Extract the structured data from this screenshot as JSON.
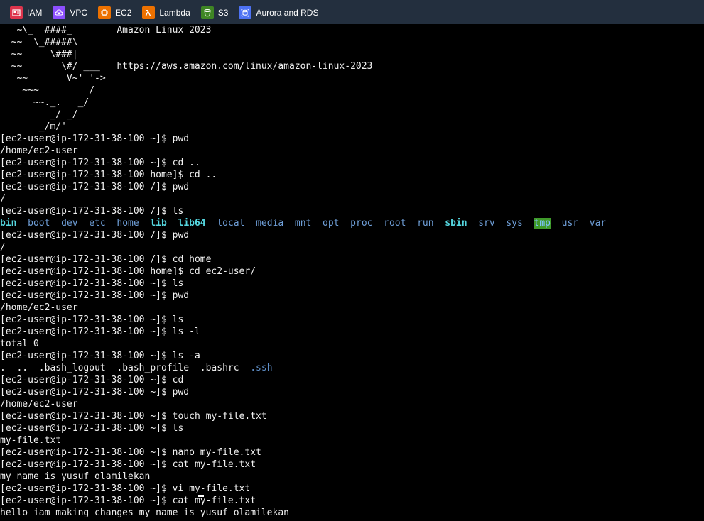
{
  "favorites": [
    {
      "label": "IAM",
      "icon": "iam-icon",
      "color": "#dd344c"
    },
    {
      "label": "VPC",
      "icon": "vpc-icon",
      "color": "#8c4fff"
    },
    {
      "label": "EC2",
      "icon": "ec2-icon",
      "color": "#ed7100"
    },
    {
      "label": "Lambda",
      "icon": "lambda-icon",
      "color": "#ed7100"
    },
    {
      "label": "S3",
      "icon": "s3-icon",
      "color": "#3f8624"
    },
    {
      "label": "Aurora and RDS",
      "icon": "rds-icon",
      "color": "#4d72f3"
    }
  ],
  "terminal": {
    "banner": [
      "   ~\\_  ####_        Amazon Linux 2023",
      "  ~~  \\_#####\\",
      "  ~~     \\###|",
      "  ~~       \\#/ ___   https://aws.amazon.com/linux/amazon-linux-2023",
      "   ~~       V~' '->",
      "    ~~~         /",
      "      ~~._.   _/",
      "         _/ _/",
      "       _/m/'"
    ],
    "prompts": {
      "home": "[ec2-user@ip-172-31-38-100 ~]$ ",
      "home_dir": "[ec2-user@ip-172-31-38-100 home]$ ",
      "root": "[ec2-user@ip-172-31-38-100 /]$ "
    },
    "history": [
      {
        "prompt": "[ec2-user@ip-172-31-38-100 ~]$ ",
        "command": "pwd"
      },
      {
        "output": "/home/ec2-user"
      },
      {
        "prompt": "[ec2-user@ip-172-31-38-100 ~]$ ",
        "command": "cd .."
      },
      {
        "prompt": "[ec2-user@ip-172-31-38-100 home]$ ",
        "command": "cd .."
      },
      {
        "prompt": "[ec2-user@ip-172-31-38-100 /]$ ",
        "command": "pwd"
      },
      {
        "output": "/"
      },
      {
        "prompt": "[ec2-user@ip-172-31-38-100 /]$ ",
        "command": "ls"
      },
      {
        "ls_root": true
      },
      {
        "prompt": "[ec2-user@ip-172-31-38-100 /]$ ",
        "command": "pwd"
      },
      {
        "output": "/"
      },
      {
        "prompt": "[ec2-user@ip-172-31-38-100 /]$ ",
        "command": "cd home"
      },
      {
        "prompt": "[ec2-user@ip-172-31-38-100 home]$ ",
        "command": "cd ec2-user/"
      },
      {
        "prompt": "[ec2-user@ip-172-31-38-100 ~]$ ",
        "command": "ls"
      },
      {
        "prompt": "[ec2-user@ip-172-31-38-100 ~]$ ",
        "command": "pwd"
      },
      {
        "output": "/home/ec2-user"
      },
      {
        "prompt": "[ec2-user@ip-172-31-38-100 ~]$ ",
        "command": "ls"
      },
      {
        "prompt": "[ec2-user@ip-172-31-38-100 ~]$ ",
        "command": "ls -l"
      },
      {
        "output": "total 0"
      },
      {
        "prompt": "[ec2-user@ip-172-31-38-100 ~]$ ",
        "command": "ls -a"
      },
      {
        "ls_hidden": true
      },
      {
        "prompt": "[ec2-user@ip-172-31-38-100 ~]$ ",
        "command": "cd"
      },
      {
        "prompt": "[ec2-user@ip-172-31-38-100 ~]$ ",
        "command": "pwd"
      },
      {
        "output": "/home/ec2-user"
      },
      {
        "prompt": "[ec2-user@ip-172-31-38-100 ~]$ ",
        "command": "touch my-file.txt"
      },
      {
        "prompt": "[ec2-user@ip-172-31-38-100 ~]$ ",
        "command": "ls"
      },
      {
        "output": "my-file.txt"
      },
      {
        "prompt": "[ec2-user@ip-172-31-38-100 ~]$ ",
        "command": "nano my-file.txt"
      },
      {
        "prompt": "[ec2-user@ip-172-31-38-100 ~]$ ",
        "command": "cat my-file.txt"
      },
      {
        "output": "my name is yusuf olamilekan"
      },
      {
        "prompt": "[ec2-user@ip-172-31-38-100 ~]$ ",
        "command": "vi my-file.txt"
      },
      {
        "prompt": "[ec2-user@ip-172-31-38-100 ~]$ ",
        "command": "cat my-file.txt"
      },
      {
        "output": "hello iam making changes my name is yusuf olamilekan"
      }
    ],
    "ls_root_entries": [
      {
        "name": "bin",
        "style": "dir-bold"
      },
      {
        "name": "boot",
        "style": "dir"
      },
      {
        "name": "dev",
        "style": "dir"
      },
      {
        "name": "etc",
        "style": "dir"
      },
      {
        "name": "home",
        "style": "dir"
      },
      {
        "name": "lib",
        "style": "dir-bold"
      },
      {
        "name": "lib64",
        "style": "dir-bold"
      },
      {
        "name": "local",
        "style": "dir"
      },
      {
        "name": "media",
        "style": "dir"
      },
      {
        "name": "mnt",
        "style": "dir"
      },
      {
        "name": "opt",
        "style": "dir"
      },
      {
        "name": "proc",
        "style": "dir"
      },
      {
        "name": "root",
        "style": "dir"
      },
      {
        "name": "run",
        "style": "dir"
      },
      {
        "name": "sbin",
        "style": "dir-bold"
      },
      {
        "name": "srv",
        "style": "dir"
      },
      {
        "name": "sys",
        "style": "dir"
      },
      {
        "name": "tmp",
        "style": "dir-tmp"
      },
      {
        "name": "usr",
        "style": "dir"
      },
      {
        "name": "var",
        "style": "dir"
      }
    ],
    "ls_hidden_entries": [
      {
        "name": ".",
        "style": "plain"
      },
      {
        "name": "..",
        "style": "plain"
      },
      {
        "name": ".bash_logout",
        "style": "plain"
      },
      {
        "name": ".bash_profile",
        "style": "plain"
      },
      {
        "name": ".bashrc",
        "style": "plain"
      },
      {
        "name": ".ssh",
        "style": "hidden-dir"
      }
    ]
  }
}
